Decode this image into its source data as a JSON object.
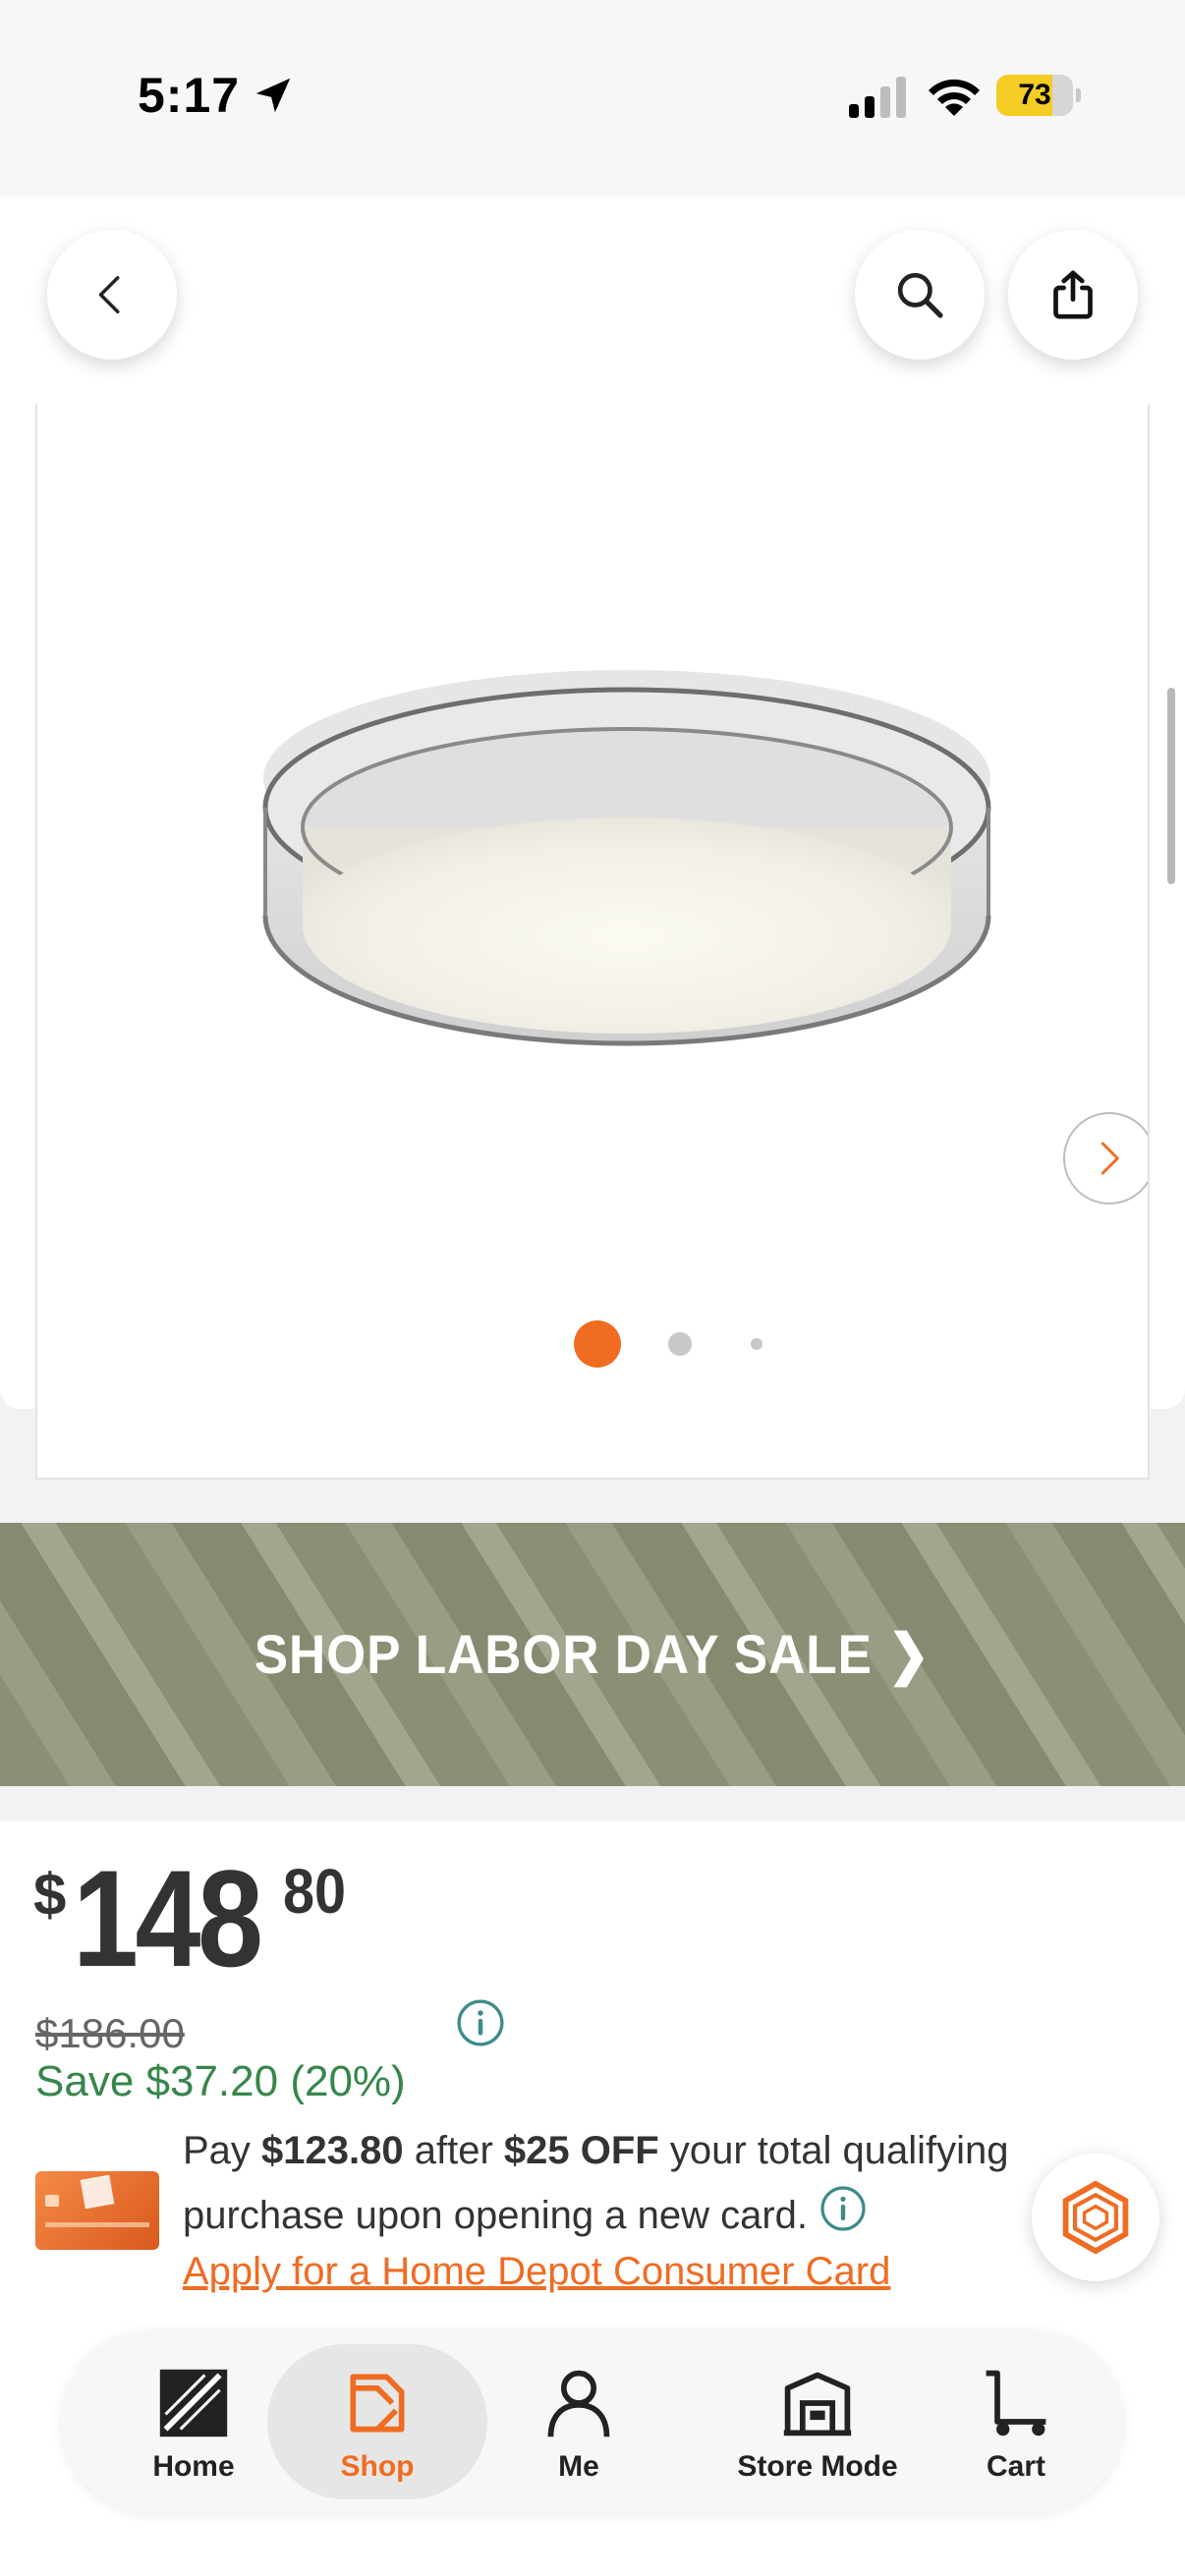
{
  "status_bar": {
    "time": "5:17",
    "battery": "73",
    "battery_level": 0.73,
    "icons": [
      "location-arrow-icon",
      "signal-icon",
      "wifi-icon",
      "battery-icon"
    ]
  },
  "header": {
    "icons": [
      "back-icon",
      "search-icon",
      "share-icon"
    ]
  },
  "gallery": {
    "image_count": 3,
    "active_index": 0,
    "accent_color": "#f06c23"
  },
  "promo": {
    "banner_text": "SHOP LABOR DAY SALE ❯"
  },
  "price": {
    "currency": "$",
    "dollars": "148",
    "cents": "80",
    "was_price": "$186.00",
    "savings": "Save $37.20 (20%)",
    "savings_color": "#36864a"
  },
  "card_offer": {
    "text_1": "Pay ",
    "amount": "$123.80",
    "text_2": " after ",
    "discount": "$25 OFF",
    "text_3": " your total qualifying purchase upon opening a new card.",
    "apply_link": "Apply for a Home Depot Consumer Card"
  },
  "tab_bar": {
    "tabs": [
      {
        "label": "Home",
        "icon": "home-depot-logo-icon"
      },
      {
        "label": "Shop",
        "icon": "shop-icon",
        "active": true
      },
      {
        "label": "Me",
        "icon": "person-icon"
      },
      {
        "label": "Store Mode",
        "icon": "store-icon"
      },
      {
        "label": "Cart",
        "icon": "cart-icon"
      }
    ]
  }
}
